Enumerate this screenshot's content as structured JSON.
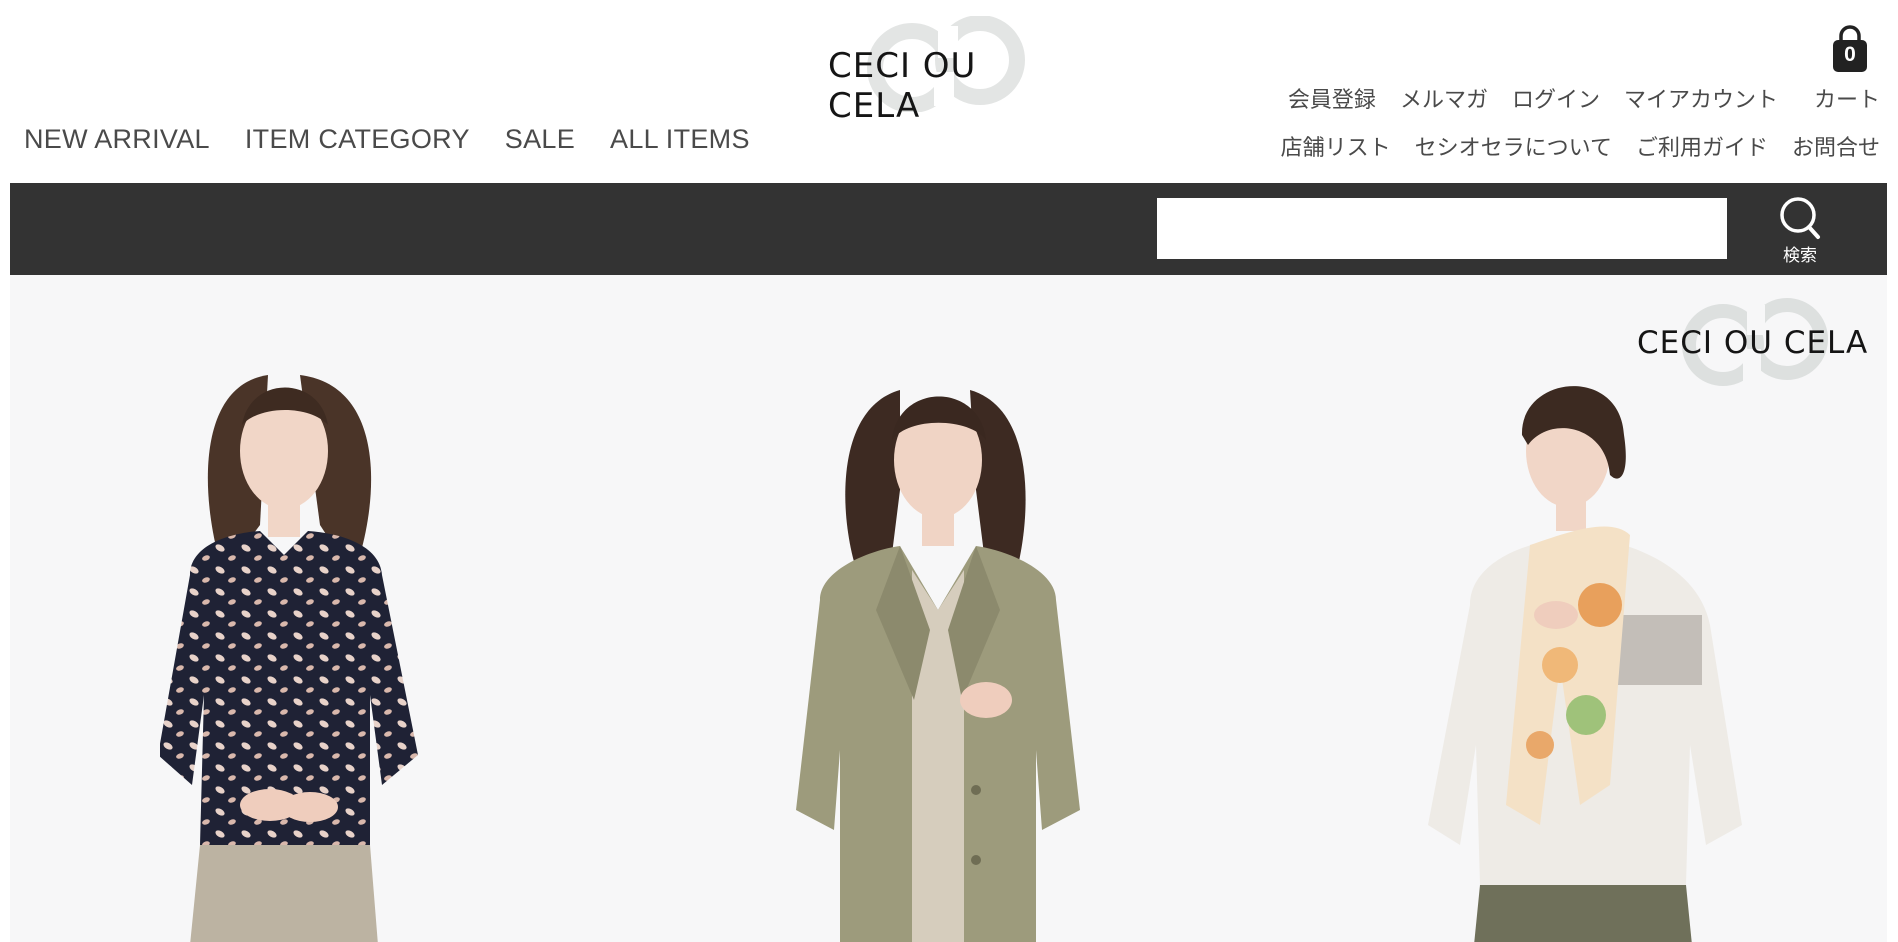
{
  "brand": {
    "name": "CECI OU CELA"
  },
  "main_nav": [
    "NEW ARRIVAL",
    "ITEM CATEGORY",
    "SALE",
    "ALL ITEMS"
  ],
  "utility_links_row1": [
    "会員登録",
    "メルマガ",
    "ログイン",
    "マイアカウント",
    "カート"
  ],
  "utility_links_row2": [
    "店舗リスト",
    "セシオセラについて",
    "ご利用ガイド",
    "お問合せ"
  ],
  "cart": {
    "count": "0",
    "icon": "shopping-bag-icon"
  },
  "search": {
    "placeholder": "",
    "button_label": "検索",
    "icon": "search-icon"
  },
  "hero": {
    "brand": "CECI OU CELA"
  },
  "colors": {
    "search_bar_bg": "#333333",
    "hero_bg": "#f7f7f8",
    "logo_mark": "#e3e5e4",
    "text": "#4a4a4a"
  }
}
